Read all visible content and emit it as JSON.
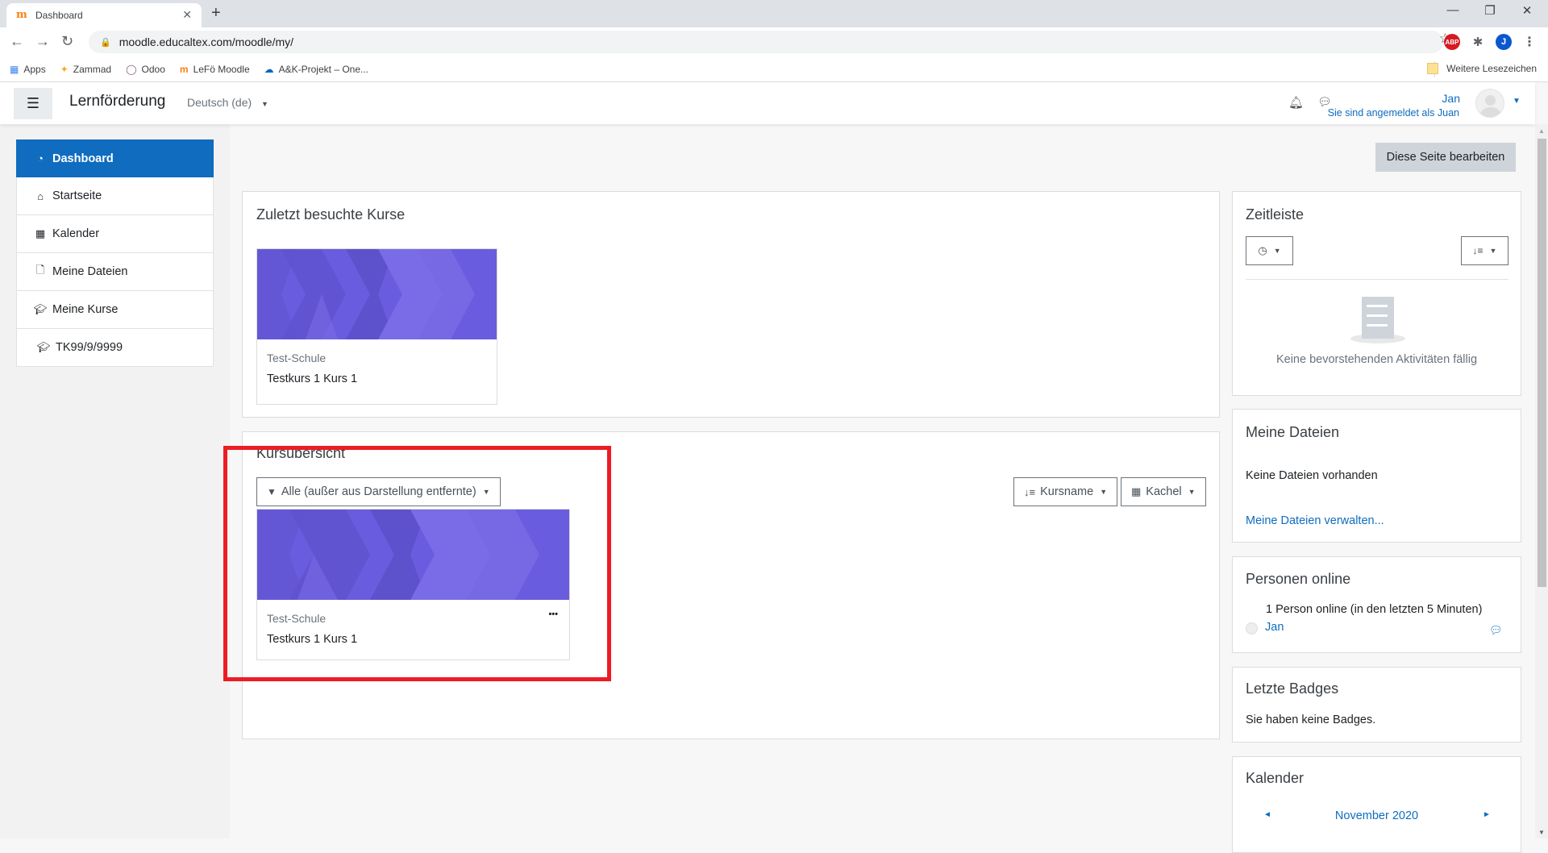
{
  "browser": {
    "tab_title": "Dashboard",
    "tab_favicon": "moodle-icon",
    "url": "moodle.educaltex.com/moodle/my/",
    "bookmarks": [
      {
        "label": "Apps",
        "icon": "apps-grid-icon"
      },
      {
        "label": "Zammad",
        "icon": "zammad-icon"
      },
      {
        "label": "Odoo",
        "icon": "odoo-icon"
      },
      {
        "label": "LeFö Moodle",
        "icon": "moodle-icon"
      },
      {
        "label": "A&K-Projekt – One...",
        "icon": "onedrive-icon"
      }
    ],
    "other_bookmarks": "Weitere Lesezeichen",
    "extensions": {
      "abp": "ABP",
      "profile_initial": "J"
    }
  },
  "navbar": {
    "site_name": "Lernförderung",
    "language": "Deutsch (de)",
    "user_name": "Jan",
    "logged_in_as": "Sie sind angemeldet als Juan"
  },
  "sidebar": {
    "items": [
      {
        "label": "Dashboard",
        "icon": "dashboard-icon",
        "active": true
      },
      {
        "label": "Startseite",
        "icon": "home-icon"
      },
      {
        "label": "Kalender",
        "icon": "calendar-icon"
      },
      {
        "label": "Meine Dateien",
        "icon": "file-icon"
      },
      {
        "label": "Meine Kurse",
        "icon": "graduation-cap-icon"
      },
      {
        "label": "TK99/9/9999",
        "icon": "graduation-cap-icon"
      }
    ]
  },
  "main": {
    "edit_page_button": "Diese Seite bearbeiten",
    "recent_courses": {
      "title": "Zuletzt besuchte Kurse",
      "courses": [
        {
          "category": "Test-Schule",
          "name": "Testkurs 1 Kurs 1"
        }
      ]
    },
    "course_overview": {
      "title": "Kursübersicht",
      "filter_label": "Alle (außer aus Darstellung entfernte)",
      "sort_label": "Kursname",
      "view_label": "Kachel",
      "courses": [
        {
          "category": "Test-Schule",
          "name": "Testkurs 1 Kurs 1",
          "menu": "•••"
        }
      ]
    }
  },
  "right_blocks": {
    "timeline": {
      "title": "Zeitleiste",
      "empty_text": "Keine bevorstehenden Aktivitäten fällig"
    },
    "my_files": {
      "title": "Meine Dateien",
      "text": "Keine Dateien vorhanden",
      "link": "Meine Dateien verwalten..."
    },
    "online_users": {
      "title": "Personen online",
      "summary": "1 Person online (in den letzten 5 Minuten)",
      "users": [
        "Jan"
      ]
    },
    "badges": {
      "title": "Letzte Badges",
      "text": "Sie haben keine Badges."
    },
    "calendar": {
      "title": "Kalender",
      "month": "November 2020",
      "prev": "◄",
      "next": "►"
    }
  },
  "colors": {
    "brand": "#0f6cbf",
    "course_image": "#6a5cdf",
    "annotation": "#ed1c24"
  }
}
